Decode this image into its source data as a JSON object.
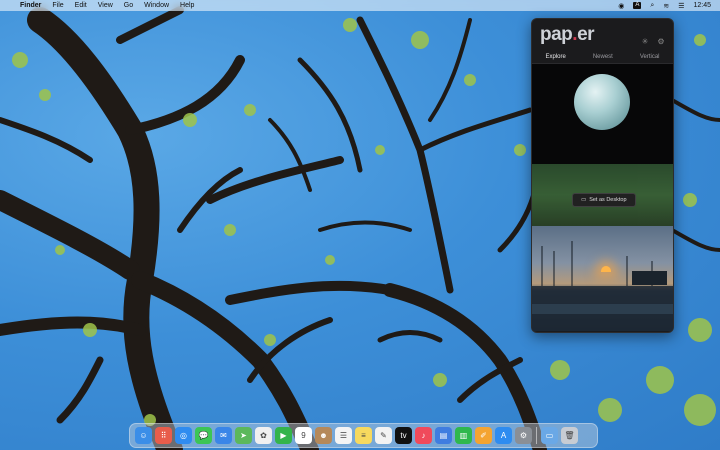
{
  "menubar": {
    "apple_glyph": "",
    "app_name": "Finder",
    "items": [
      "File",
      "Edit",
      "View",
      "Go",
      "Window",
      "Help"
    ],
    "input_badge": "A",
    "clock": "12:45"
  },
  "paper_app": {
    "logo_main": "pap",
    "logo_accent": ".",
    "logo_end": "er",
    "tabs": [
      "Explore",
      "Newest",
      "Vertical"
    ],
    "active_tab": "Explore",
    "set_desktop_label": "Set as Desktop"
  },
  "dock": {
    "apps": [
      {
        "name": "finder-icon",
        "color": "#3b8ee8",
        "glyph": "☺"
      },
      {
        "name": "launchpad-icon",
        "color": "#e85d4b",
        "glyph": "⠿"
      },
      {
        "name": "safari-icon",
        "color": "#2f8cf0",
        "glyph": "◎"
      },
      {
        "name": "messages-icon",
        "color": "#3cc556",
        "glyph": "💬"
      },
      {
        "name": "mail-icon",
        "color": "#3a86e8",
        "glyph": "✉"
      },
      {
        "name": "maps-icon",
        "color": "#5cb85c",
        "glyph": "➤"
      },
      {
        "name": "photos-icon",
        "color": "#f0f0f0",
        "glyph": "✿"
      },
      {
        "name": "facetime-icon",
        "color": "#34b44b",
        "glyph": "▶"
      },
      {
        "name": "calendar-icon",
        "color": "#ffffff",
        "glyph": "9"
      },
      {
        "name": "contacts-icon",
        "color": "#b5895a",
        "glyph": "☻"
      },
      {
        "name": "reminders-icon",
        "color": "#f4f4f4",
        "glyph": "☰"
      },
      {
        "name": "notes-icon",
        "color": "#f7d95e",
        "glyph": "≡"
      },
      {
        "name": "freeform-icon",
        "color": "#f2f2f2",
        "glyph": "✎"
      },
      {
        "name": "appletv-icon",
        "color": "#111111",
        "glyph": "tv"
      },
      {
        "name": "music-icon",
        "color": "#f04a5b",
        "glyph": "♪"
      },
      {
        "name": "keynote-icon",
        "color": "#3f7de0",
        "glyph": "▤"
      },
      {
        "name": "numbers-icon",
        "color": "#2fb84d",
        "glyph": "▥"
      },
      {
        "name": "pages-icon",
        "color": "#f4a431",
        "glyph": "✐"
      },
      {
        "name": "appstore-icon",
        "color": "#2e8cf0",
        "glyph": "A"
      },
      {
        "name": "settings-icon",
        "color": "#8a8f96",
        "glyph": "⚙"
      }
    ],
    "trailing": [
      {
        "name": "downloads-folder-icon",
        "color": "#6aa8e6",
        "glyph": "▭"
      },
      {
        "name": "trash-icon",
        "color": "#c7ccd3",
        "glyph": "🗑"
      }
    ]
  }
}
